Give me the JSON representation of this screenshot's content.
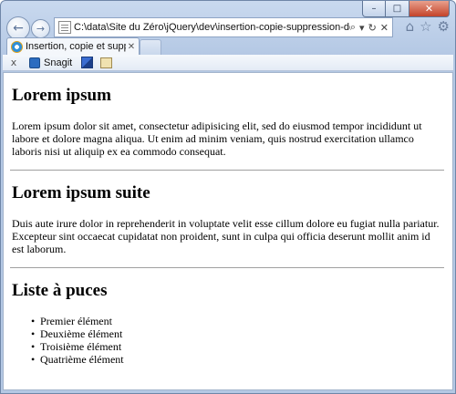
{
  "browser": {
    "address": "C:\\data\\Site du Zéro\\jQuery\\dev\\insertion-copie-suppression-donnees.htm",
    "tab_title": "Insertion, copie et suppressi...",
    "caption": {
      "minimize": "–",
      "maximize": "□",
      "close": "✕"
    },
    "nav": {
      "back": "←",
      "forward": "→"
    },
    "address_icons": {
      "search": "⌕",
      "dropdown": "▾",
      "refresh": "↻",
      "stop": "✕"
    },
    "tab_close": "✕",
    "right_icons": {
      "home": "⌂",
      "favorites": "☆",
      "tools": "⚙"
    },
    "commandbar": {
      "close": "x",
      "snagit_label": "Snagit"
    }
  },
  "page": {
    "sections": [
      {
        "heading": "Lorem ipsum",
        "text": "Lorem ipsum dolor sit amet, consectetur adipisicing elit, sed do eiusmod tempor incididunt ut labore et dolore magna aliqua. Ut enim ad minim veniam, quis nostrud exercitation ullamco laboris nisi ut aliquip ex ea commodo consequat."
      },
      {
        "heading": "Lorem ipsum suite",
        "text": "Duis aute irure dolor in reprehenderit in voluptate velit esse cillum dolore eu fugiat nulla pariatur. Excepteur sint occaecat cupidatat non proident, sunt in culpa qui officia deserunt mollit anim id est laborum."
      },
      {
        "heading": "Liste à puces",
        "items": [
          "Premier élément",
          "Deuxième élément",
          "Troisième élément",
          "Quatrième élément"
        ]
      }
    ]
  }
}
